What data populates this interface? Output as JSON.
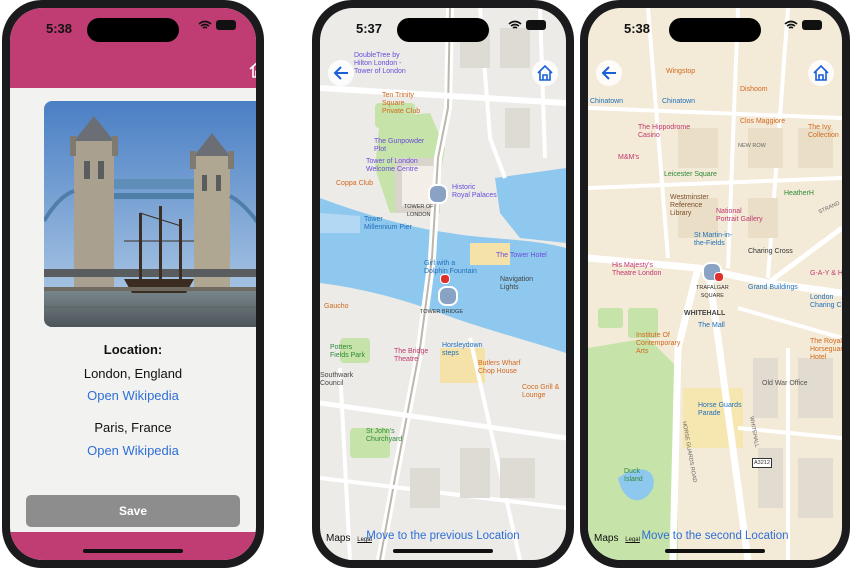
{
  "phone1": {
    "status_time": "5:38",
    "location_title": "Location:",
    "entries": [
      {
        "place": "London, England",
        "link": "Open Wikipedia"
      },
      {
        "place": "Paris, France",
        "link": "Open Wikipedia"
      }
    ],
    "save_label": "Save",
    "colors": {
      "header": "#bf3d73",
      "button": "#8d8d8d",
      "link": "#2f6fd6"
    }
  },
  "phone2": {
    "status_time": "5:37",
    "move_link": "Move to the previous Location",
    "maps_logo": "Maps",
    "legal": "Legal",
    "labels": {
      "doubletree": "DoubleTree by\nHilton London -\nTower of London",
      "ten_trinity": "Ten Trinity\nSquare\nPrivate Club",
      "gunpowder": "The Gunpowder\nPlot",
      "tower_welcome": "Tower of London\nWelcome Centre",
      "coppa": "Coppa Club",
      "tower_of_london": "TOWER OF\nLONDON",
      "historic_palaces": "Historic\nRoyal Palaces",
      "tower_millennium": "Tower\nMillennium Pier",
      "girl_dolphin": "Girl with a\nDolphin Fountain",
      "tower_hotel": "The Tower Hotel",
      "navigation_lights": "Navigation\nLights",
      "tower_bridge": "TOWER BRIDGE",
      "gaucho": "Gaucho",
      "potters_fields": "Potters\nFields Park",
      "bridge_theatre": "The Bridge\nTheatre",
      "horsleydown": "Horsleydown\nsteps",
      "butlers_wharf": "Butlers Wharf\nChop House",
      "southwark": "Southwark\nCouncil",
      "coco_grill": "Coco Grill &\nLounge",
      "st_johns": "St John's\nChurchyard"
    }
  },
  "phone3": {
    "status_time": "5:38",
    "move_link": "Move to the second Location",
    "maps_logo": "Maps",
    "legal": "Legal",
    "labels": {
      "wingstop": "Wingstop",
      "dishoom": "Dishoom",
      "chinatown1": "Chinatown",
      "chinatown2": "Chinatown",
      "hippodrome": "The Hippodrome\nCasino",
      "clos_maggiore": "Clos Maggiore",
      "ivy": "The Ivy\nCollection",
      "mm": "M&M's",
      "leicester": "Leicester Square",
      "heatherh": "HeatherH",
      "westminster_lib": "Westminster\nReference\nLibrary",
      "portrait": "National\nPortrait Gallery",
      "st_martin": "St Martin-in-\nthe-Fields",
      "charing_cross": "Charing Cross",
      "his_majestys": "His Majesty's\nTheatre London",
      "trafalgar": "TRAFALGAR\nSQUARE",
      "grand_buildings": "Grand Buildings",
      "gay_h": "G-A-Y & H",
      "london_charing": "London\nCharing Cross",
      "whitehall": "WHITEHALL",
      "the_mall": "The Mall",
      "ica": "Institute Of\nContemporary\nArts",
      "royal_horseguards": "The Royal\nHorseguards\nHotel",
      "old_war_office": "Old War Office",
      "horse_guards_parade": "Horse Guards\nParade",
      "horse_guards_road": "HORSE GUARDS ROAD",
      "whitehall_road": "WHITEHALL",
      "a3212": "A3212",
      "duck_island": "Duck\nIsland",
      "strand": "STRAND",
      "new_row": "NEW ROW"
    }
  }
}
